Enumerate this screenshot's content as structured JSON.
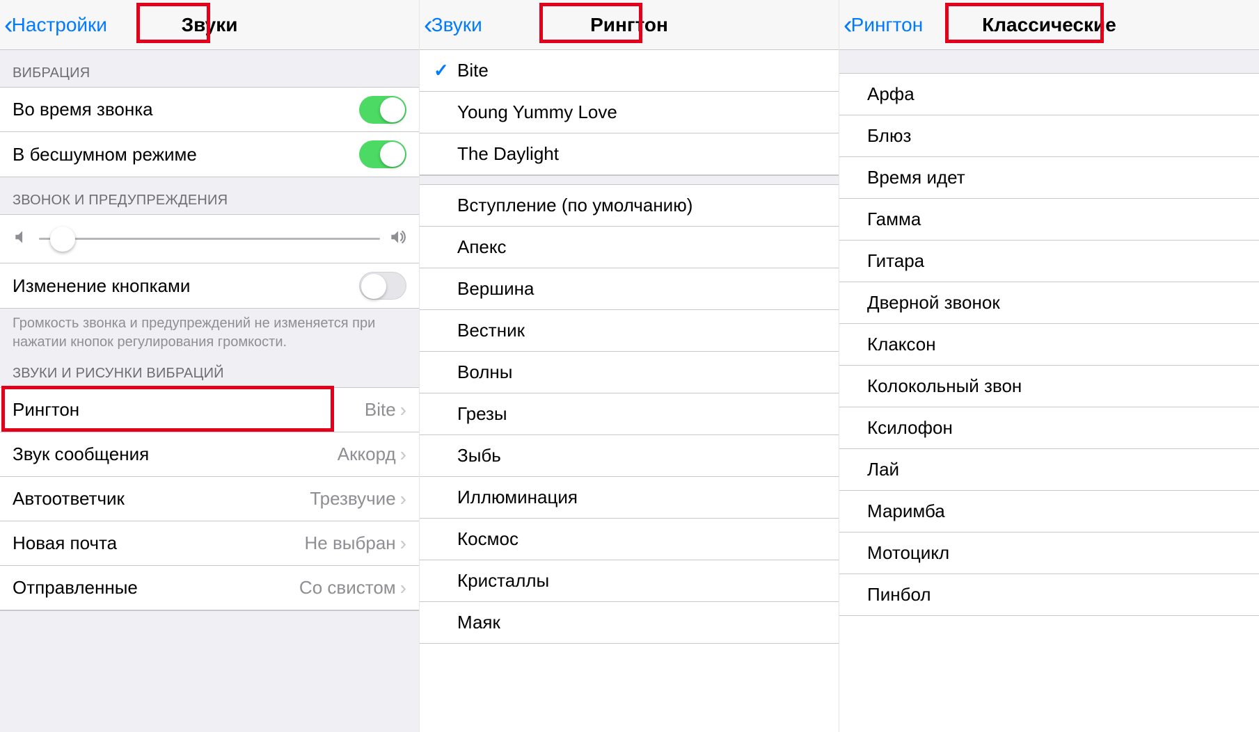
{
  "screen1": {
    "back": "Настройки",
    "title": "Звуки",
    "section_vibration": "ВИБРАЦИЯ",
    "vibrate_on_ring": "Во время звонка",
    "vibrate_on_silent": "В бесшумном режиме",
    "section_ringer": "ЗВОНОК И ПРЕДУПРЕЖДЕНИЯ",
    "change_with_buttons": "Изменение кнопками",
    "footer_ringer": "Громкость звонка и предупреждений не изменяется при нажатии кнопок регулирования громкости.",
    "section_sounds": "ЗВУКИ И РИСУНКИ ВИБРАЦИЙ",
    "rows": {
      "ringtone": {
        "label": "Рингтон",
        "value": "Bite"
      },
      "texttone": {
        "label": "Звук сообщения",
        "value": "Аккорд"
      },
      "voicemail": {
        "label": "Автоответчик",
        "value": "Трезвучие"
      },
      "newmail": {
        "label": "Новая почта",
        "value": "Не выбран"
      },
      "sentmail": {
        "label": "Отправленные",
        "value": "Со свистом"
      }
    }
  },
  "screen2": {
    "back": "Звуки",
    "title": "Рингтон",
    "custom": [
      {
        "label": "Bite",
        "checked": true
      },
      {
        "label": "Young Yummy Love",
        "checked": false
      },
      {
        "label": "The Daylight",
        "checked": false
      }
    ],
    "builtin": [
      "Вступление (по умолчанию)",
      "Апекс",
      "Вершина",
      "Вестник",
      "Волны",
      "Грезы",
      "Зыбь",
      "Иллюминация",
      "Космос",
      "Кристаллы",
      "Маяк"
    ]
  },
  "screen3": {
    "back": "Рингтон",
    "title": "Классические",
    "items": [
      "Арфа",
      "Блюз",
      "Время идет",
      "Гамма",
      "Гитара",
      "Дверной звонок",
      "Клаксон",
      "Колокольный звон",
      "Ксилофон",
      "Лай",
      "Маримба",
      "Мотоцикл",
      "Пинбол"
    ]
  }
}
